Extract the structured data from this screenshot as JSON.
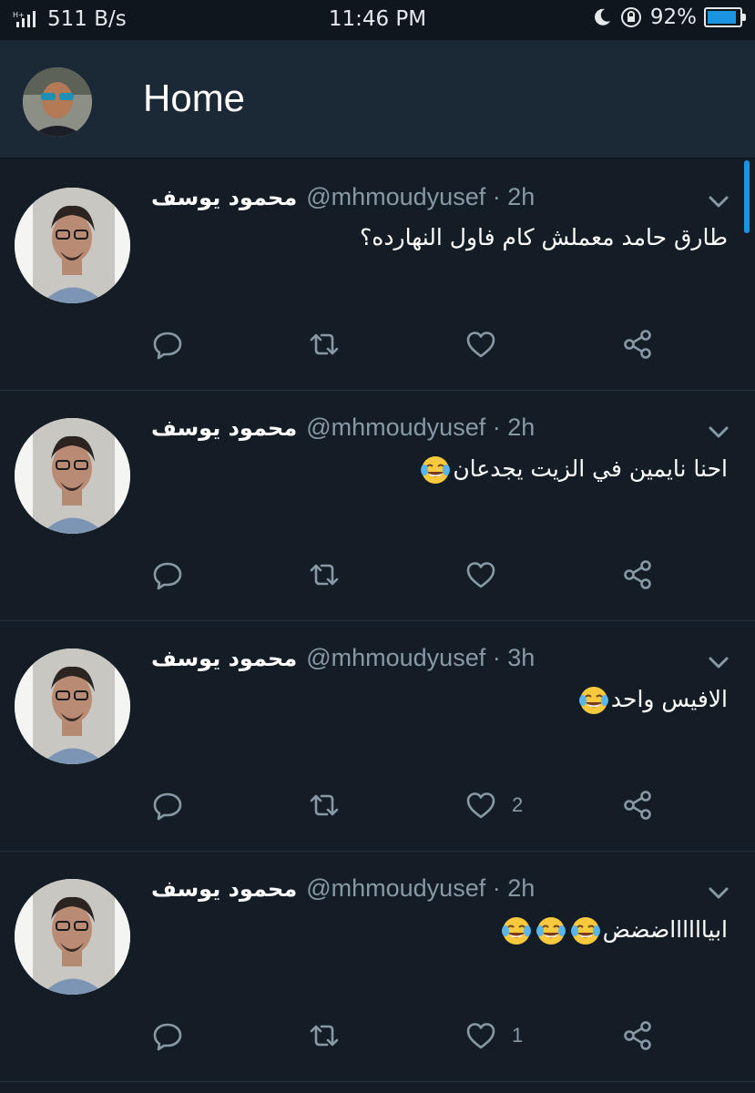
{
  "status_bar": {
    "network_speed": "511 B/s",
    "time": "11:46 PM",
    "battery_percent": "92%",
    "battery_level": 0.92
  },
  "header": {
    "title": "Home"
  },
  "tweets": [
    {
      "name": "محمود يوسف",
      "handle": "@mhmoudyusef · 2h",
      "text": "طارق حامد معملش كام فاول النهارده؟",
      "emoji_count": 0,
      "like_count": ""
    },
    {
      "name": "محمود يوسف",
      "handle": "@mhmoudyusef · 2h",
      "text": "احنا نايمين في الزيت يجدعان",
      "emoji_count": 1,
      "like_count": ""
    },
    {
      "name": "محمود يوسف",
      "handle": "@mhmoudyusef · 3h",
      "text": "الافيس واحد",
      "emoji_count": 1,
      "like_count": "2"
    },
    {
      "name": "محمود يوسف",
      "handle": "@mhmoudyusef · 2h",
      "text": "ابيااااااضضض",
      "emoji_count": 3,
      "like_count": "1"
    }
  ],
  "icons": {
    "reply": "reply-icon",
    "retweet": "retweet-icon",
    "like": "heart-icon",
    "share": "share-icon",
    "caret": "chevron-down-icon",
    "emoji": "face-with-tears-of-joy-icon"
  },
  "colors": {
    "background": "#141d26",
    "header": "#1b2836",
    "accent": "#1b95e0",
    "secondary_text": "#8899a6"
  }
}
